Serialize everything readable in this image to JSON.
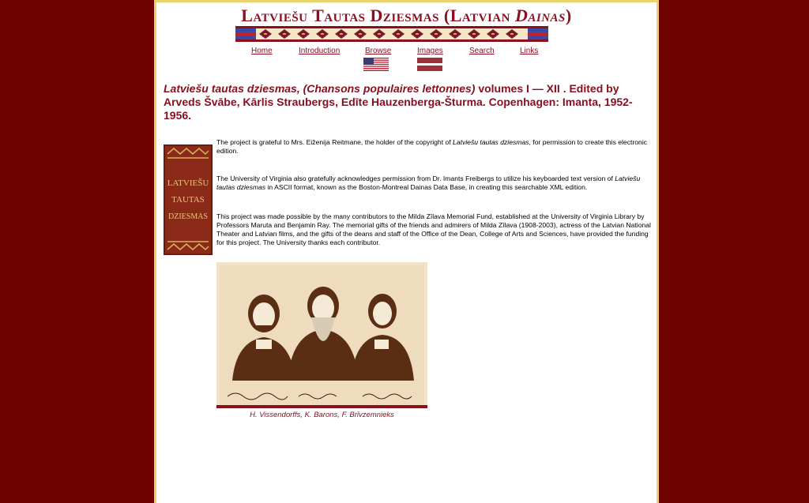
{
  "header": {
    "title_part1": "Latviešu Tautas Dziesmas (Latvian ",
    "title_part2": "Dainas",
    "title_part3": ")"
  },
  "nav": {
    "items": [
      {
        "label": "Home"
      },
      {
        "label": "Introduction"
      },
      {
        "label": "Browse"
      },
      {
        "label": "Images"
      },
      {
        "label": "Search"
      },
      {
        "label": "Links"
      }
    ]
  },
  "colors": {
    "background": "#6e0000",
    "accent": "#8a1020",
    "border": "#e9d16b"
  },
  "main": {
    "heading_italic": "Latviešu tautas dziesmas, (Chansons populaires lettonnes)",
    "heading_rest": " volumes I — XII . Edited by Arveds Švābe, Kārlis Straubergs, Edīte Hauzenberga-Šturma. Copenhagen: Imanta, 1952-1956.",
    "book_cover_text": [
      "LATVIEŠU",
      "TAUTAS",
      "DZIESMAS"
    ],
    "p1_a": "The project is grateful to Mrs. Eiženija Reitmane, the holder of the copyright of ",
    "p1_it": "Latviešu tautas dziesmas",
    "p1_b": ", for permission to create this electronic edition.",
    "p2_a": "The University of Virginia also gratefully acknowledges permission from Dr. Imants Freibergs to utilize his keyboarded text version of ",
    "p2_it": "Latviešu tautas dziesmas",
    "p2_b": " in ASCII format, known as the Boston-Montreal Dainas Data Base, in creating this searchable XML edition.",
    "p3": "This project was made possible by the many contributors to the Milda Zīlava Memorial Fund, established at the University of Virginia Library by Professors Maruta and Benjamin Ray. The memorial gifts of the friends and admirers of Milda Zīlava (1908-2003), actress of the Latvian National Theater and Latvian films, and the gifts of the deans and staff of the Office of the Dean, College of Arts and Sciences, have provided the funding for this project. The University thanks each contributor.",
    "caption": "H. Vissendorffs, K. Barons, F. Brīvzemnieks"
  }
}
